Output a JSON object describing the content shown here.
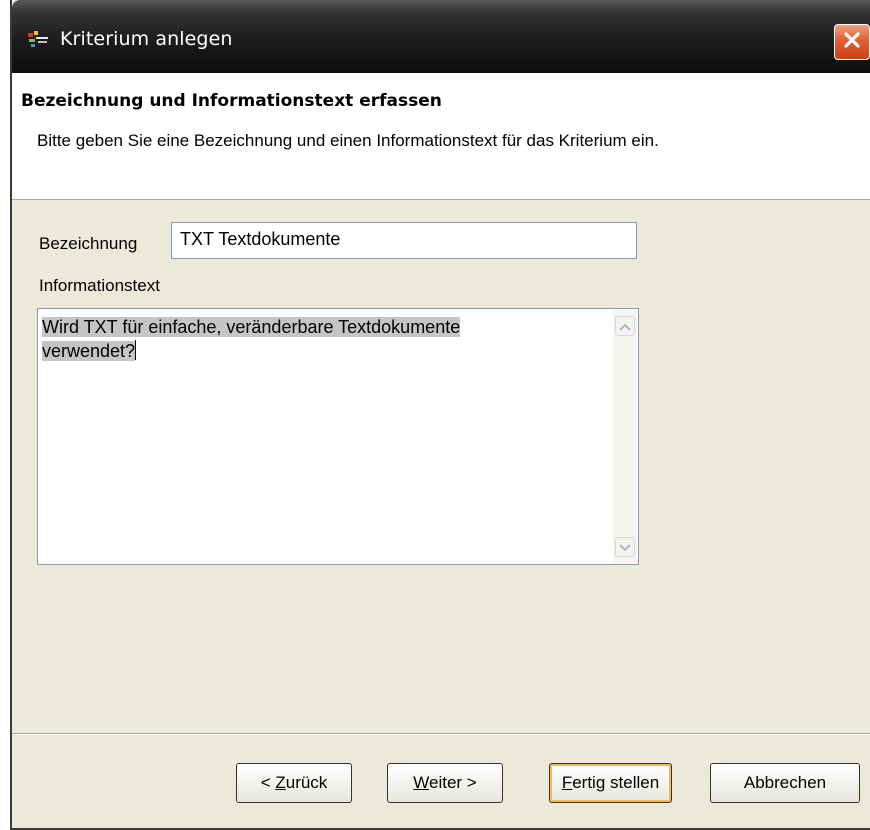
{
  "window": {
    "title": "Kriterium anlegen",
    "accent_close_color": "#e2602f"
  },
  "header": {
    "title": "Bezeichnung und Informationstext erfassen",
    "description": "Bitte geben Sie eine Bezeichnung und einen Informationstext für das Kriterium ein."
  },
  "form": {
    "bezeichnung_label": "Bezeichnung",
    "bezeichnung_value": "TXT Textdokumente",
    "info_label": "Informationstext",
    "info_line1": "Wird TXT für einfache, veränderbare Textdokumente",
    "info_line2": "verwendet?"
  },
  "buttons": {
    "back_prefix": "< ",
    "back_mnemonic": "Z",
    "back_rest": "urück",
    "next_mnemonic": "W",
    "next_rest": "eiter >",
    "finish_mnemonic": "F",
    "finish_rest": "ertig stellen",
    "cancel": "Abbrechen"
  },
  "icons": {
    "app": "app-icon",
    "close": "close-icon",
    "scroll_up": "chevron-up-icon",
    "scroll_down": "chevron-down-icon"
  }
}
